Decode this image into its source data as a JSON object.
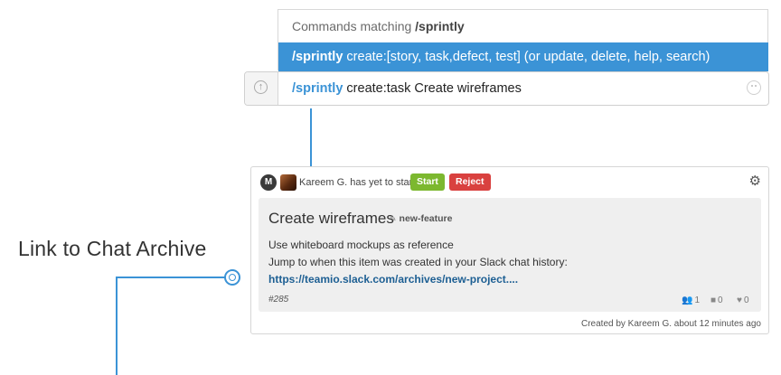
{
  "annotation": {
    "label": "Link to Chat Archive"
  },
  "command_popup": {
    "header_prefix": "Commands matching ",
    "header_query": "/sprintly",
    "option_command": "/sprintly",
    "option_text": " create:[story, task,defect, test]  (or update, delete, help, search)"
  },
  "message_input": {
    "command": "/sprintly",
    "text": " create:task Create wireframes",
    "upload_icon": "upload-arrow-icon",
    "emoji_icon": "smiley-icon"
  },
  "card": {
    "avatar_initial": "M",
    "status": "Kareem G. has yet to start.",
    "start_label": "Start",
    "reject_label": "Reject",
    "title": "Create wireframes",
    "tag": "new-feature",
    "description_line1": "Use whiteboard mockups as reference",
    "description_line2": "Jump to when this item was created in your Slack chat history:",
    "link": "https://teamio.slack.com/archives/new-project....",
    "item_id": "#285",
    "users_count": "1",
    "comments_count": "0",
    "likes_count": "0",
    "created_by": "Created by Kareem G. about 12 minutes ago"
  },
  "colors": {
    "accent": "#3b93d6",
    "start": "#7cb82f",
    "reject": "#d9413f"
  }
}
